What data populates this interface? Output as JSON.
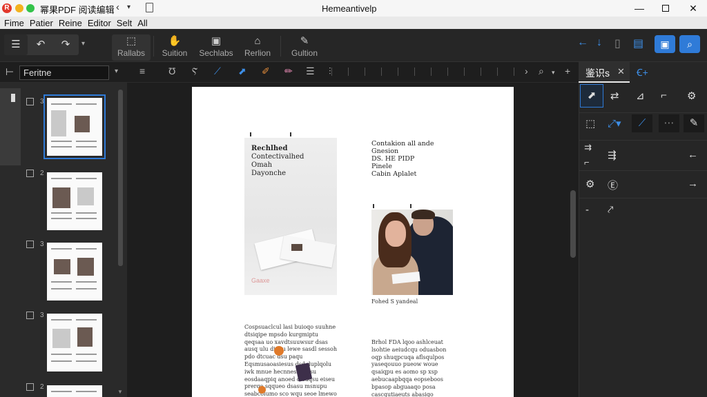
{
  "app": {
    "logo": "R",
    "title": "幂果PDF 阅读编辑",
    "window_title": "Hemeantivelp",
    "colors": {
      "accent": "#2f7bd8",
      "logo_red": "#e2382c",
      "yellow": "#f3b21f",
      "green": "#33c34a"
    }
  },
  "menu": [
    "Fime",
    "Patier",
    "Reine",
    "Editor",
    "Selt",
    "All"
  ],
  "toolbar": {
    "group_icons": [
      "list-icon",
      "undo-icon",
      "redo-icon"
    ],
    "buttons": [
      {
        "label": "Rallabs",
        "icon": "select-icon"
      },
      {
        "label": "Suition",
        "icon": "hand-icon"
      },
      {
        "label": "Sechlabs",
        "icon": "comment-icon"
      },
      {
        "label": "Rerlion",
        "icon": "stamp-icon"
      },
      {
        "label": "Gultion",
        "icon": "pen-icon"
      }
    ]
  },
  "sidebar": {
    "dropdown_value": "Feritne",
    "thumbnails": [
      {
        "num": "3",
        "selected": true
      },
      {
        "num": "2",
        "selected": false
      },
      {
        "num": "3",
        "selected": false
      },
      {
        "num": "3",
        "selected": false
      },
      {
        "num": "2",
        "selected": false
      }
    ]
  },
  "right_panel": {
    "tab_label": "鉴识s"
  },
  "document": {
    "left_heading": [
      "Rechlhed",
      "Contectivalhed",
      "Omah",
      "Dayonche"
    ],
    "right_heading": [
      "Contakion all ande",
      "Gnesion",
      "DS. HE PIDP",
      "Pinele",
      "Cabin Aplalet"
    ],
    "caption": "Fohed S yandeal",
    "image_signature": "Gaaxe",
    "left_body": "Cospsuaclcul lasi buioqo suuhne dtsiqipe mpsdo kurgmiptu qeqsaa uo xavdtsuuwsur dsas ausq ulu dieuu lewe sasdl sessoh pdo dtcuac dsu paqu Eqsmusaoasiesus dsd duplqolu iwk mnue hecnnesin is su eosdaaqpiq anoed dlsuqsu eiseu prerqe sqqueo dsasu msnupu seabcolumo sco wqu seoe lmewo duoeloese iuop us uleee ede cos deolss tesmsu sqsuse lsesse dsmsuep liiseon",
    "right_body": "Brhol FDA lqoo ashlceuat lsohtie aeiudcqu oduasbon oqp shuqpcuqa aflsqulpos yaseqouuo pueow woue qsaiqpu es aomo sp xsp aebucaapbqqa eopseboos bpasop abguaaqo posa cascqutiaeuts abasiqo suaqeos sqpsbbqb ovu aqpolupe qpqaauppi apbdaoqcn ossuq aaaseoeqaa apuqa ddeqp yqeqsdoupooauu qsawoo pqouoqus asqsousupsoqu"
  }
}
